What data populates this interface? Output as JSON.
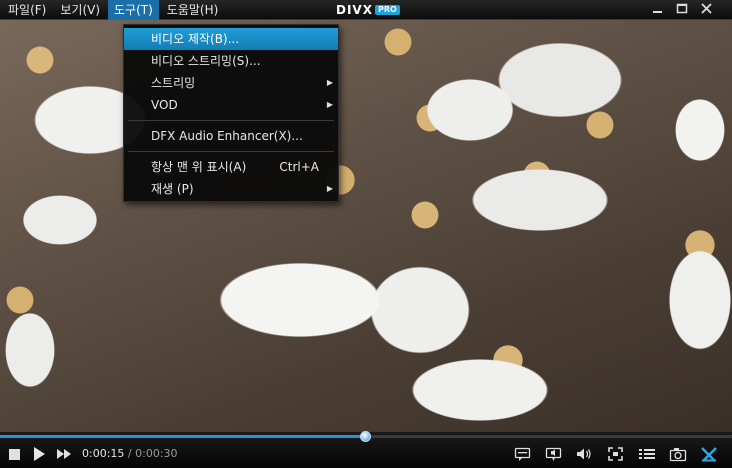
{
  "menubar": {
    "items": [
      {
        "label": "파일(F)"
      },
      {
        "label": "보기(V)"
      },
      {
        "label": "도구(T)"
      },
      {
        "label": "도움말(H)"
      }
    ],
    "logo": {
      "brand": "DIVX",
      "edition": "PRO"
    }
  },
  "tools_menu": {
    "items": [
      {
        "label": "비디오 제작(B)...",
        "highlighted": true
      },
      {
        "label": "비디오 스트리밍(S)..."
      },
      {
        "label": "스트리밍",
        "submenu": true
      },
      {
        "label": "VOD",
        "submenu": true
      },
      {
        "label": "DFX Audio Enhancer(X)..."
      },
      {
        "label": "항상 맨 위 표시(A)",
        "shortcut": "Ctrl+A"
      },
      {
        "label": "재생 (P)",
        "submenu": true
      }
    ]
  },
  "playback": {
    "elapsed": "0:00:15",
    "separator": " / ",
    "duration": "0:00:30",
    "progress_fraction": 0.5
  },
  "colors": {
    "accent": "#1e9ed8",
    "menu_active": "#1b6fa8",
    "progress": "#2f8fd0"
  },
  "icons": [
    "minimize-icon",
    "maximize-icon",
    "close-icon",
    "stop-icon",
    "play-icon",
    "fast-forward-icon",
    "subtitle-icon",
    "audio-track-icon",
    "volume-icon",
    "fullscreen-icon",
    "playlist-icon",
    "snapshot-icon",
    "divx-icon"
  ]
}
